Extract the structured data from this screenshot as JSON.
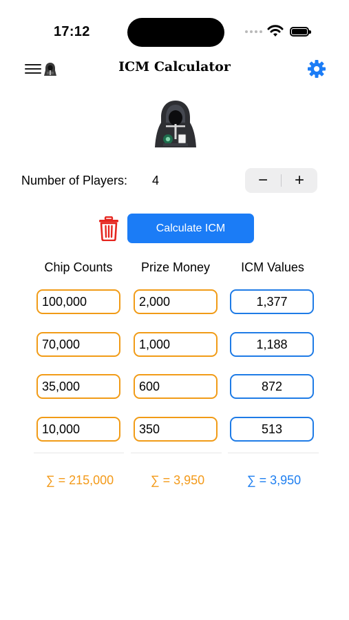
{
  "status_bar": {
    "time": "17:12"
  },
  "nav": {
    "title": "ICM Calculator"
  },
  "players": {
    "label": "Number of Players:",
    "count": "4",
    "decrement": "−",
    "increment": "+"
  },
  "actions": {
    "calculate_label": "Calculate ICM"
  },
  "table": {
    "headers": [
      "Chip Counts",
      "Prize Money",
      "ICM Values"
    ],
    "rows": [
      {
        "chips": "100,000",
        "prize": "2,000",
        "icm": "1,377"
      },
      {
        "chips": "70,000",
        "prize": "1,000",
        "icm": "1,188"
      },
      {
        "chips": "35,000",
        "prize": "600",
        "icm": "872"
      },
      {
        "chips": "10,000",
        "prize": "350",
        "icm": "513"
      }
    ],
    "totals": {
      "chips": "∑ = 215,000",
      "prize": "∑ = 3,950",
      "icm": "∑ = 3,950"
    }
  },
  "icons": [
    "hamburger-menu-icon",
    "hooded-avatar-icon",
    "gear-icon",
    "trash-icon",
    "wifi-icon",
    "battery-icon",
    "cellular-signal-icon"
  ],
  "colors": {
    "accent_blue": "#1b7cf6",
    "accent_orange": "#f19b16",
    "destructive_red": "#e5261f"
  }
}
